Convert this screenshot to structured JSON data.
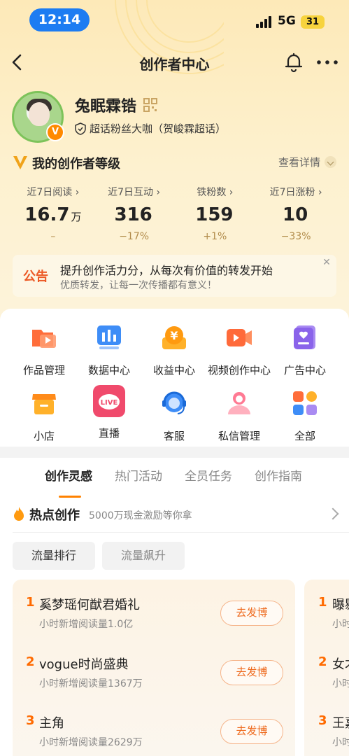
{
  "status_bar": {
    "time": "12:14",
    "network": "5G",
    "battery": "31"
  },
  "nav": {
    "title": "创作者中心"
  },
  "profile": {
    "name": "兔眠霖锆",
    "role": "超话粉丝大咖（贺峻霖超话）",
    "badge": "V"
  },
  "level": {
    "title": "我的创作者等级",
    "detail_label": "查看详情"
  },
  "stats": [
    {
      "label": "近7日阅读 ›",
      "value": "16.7",
      "unit": "万",
      "change": "–"
    },
    {
      "label": "近7日互动 ›",
      "value": "316",
      "unit": "",
      "change": "−17%"
    },
    {
      "label": "铁粉数 ›",
      "value": "159",
      "unit": "",
      "change": "+1%"
    },
    {
      "label": "近7日涨粉 ›",
      "value": "10",
      "unit": "",
      "change": "−33%"
    }
  ],
  "notice": {
    "tag": "公告",
    "title": "提升创作活力分，从每次有价值的转发开始",
    "subtitle": "优质转发，让每一次传播都有意义！"
  },
  "tools": [
    {
      "label": "作品管理",
      "icon": "works-icon"
    },
    {
      "label": "数据中心",
      "icon": "data-icon"
    },
    {
      "label": "收益中心",
      "icon": "income-icon"
    },
    {
      "label": "视频创作中心",
      "icon": "video-icon"
    },
    {
      "label": "广告中心",
      "icon": "ad-icon"
    },
    {
      "label": "小店",
      "icon": "shop-icon"
    },
    {
      "label": "直播",
      "icon": "live-icon"
    },
    {
      "label": "客服",
      "icon": "service-icon"
    },
    {
      "label": "私信管理",
      "icon": "message-icon"
    },
    {
      "label": "全部",
      "icon": "all-icon"
    }
  ],
  "live_icon_text": "LIVE",
  "income_icon_text": "¥",
  "tabs": [
    "创作灵感",
    "热门活动",
    "全员任务",
    "创作指南"
  ],
  "hot": {
    "title": "热点创作",
    "subtitle": "5000万现金激励等你拿"
  },
  "chips": [
    "流量排行",
    "流量飙升"
  ],
  "hot_list": [
    {
      "rank": "1",
      "title": "奚梦瑶何猷君婚礼",
      "sub": "小时新增阅读量1.0亿",
      "button": "去发博"
    },
    {
      "rank": "2",
      "title": "vogue时尚盛典",
      "sub": "小时新增阅读量1367万",
      "button": "去发博"
    },
    {
      "rank": "3",
      "title": "主角",
      "sub": "小时新增阅读量2629万",
      "button": "去发博"
    }
  ],
  "peek_list": [
    {
      "rank": "1",
      "title": "曝剔",
      "sub": "小时"
    },
    {
      "rank": "2",
      "title": "女才",
      "sub": "小时"
    },
    {
      "rank": "3",
      "title": "王嘉",
      "sub": "小时"
    }
  ],
  "colors": {
    "accent": "#ff8200",
    "rank": "#ff6a00",
    "live": "#f04a6c"
  }
}
